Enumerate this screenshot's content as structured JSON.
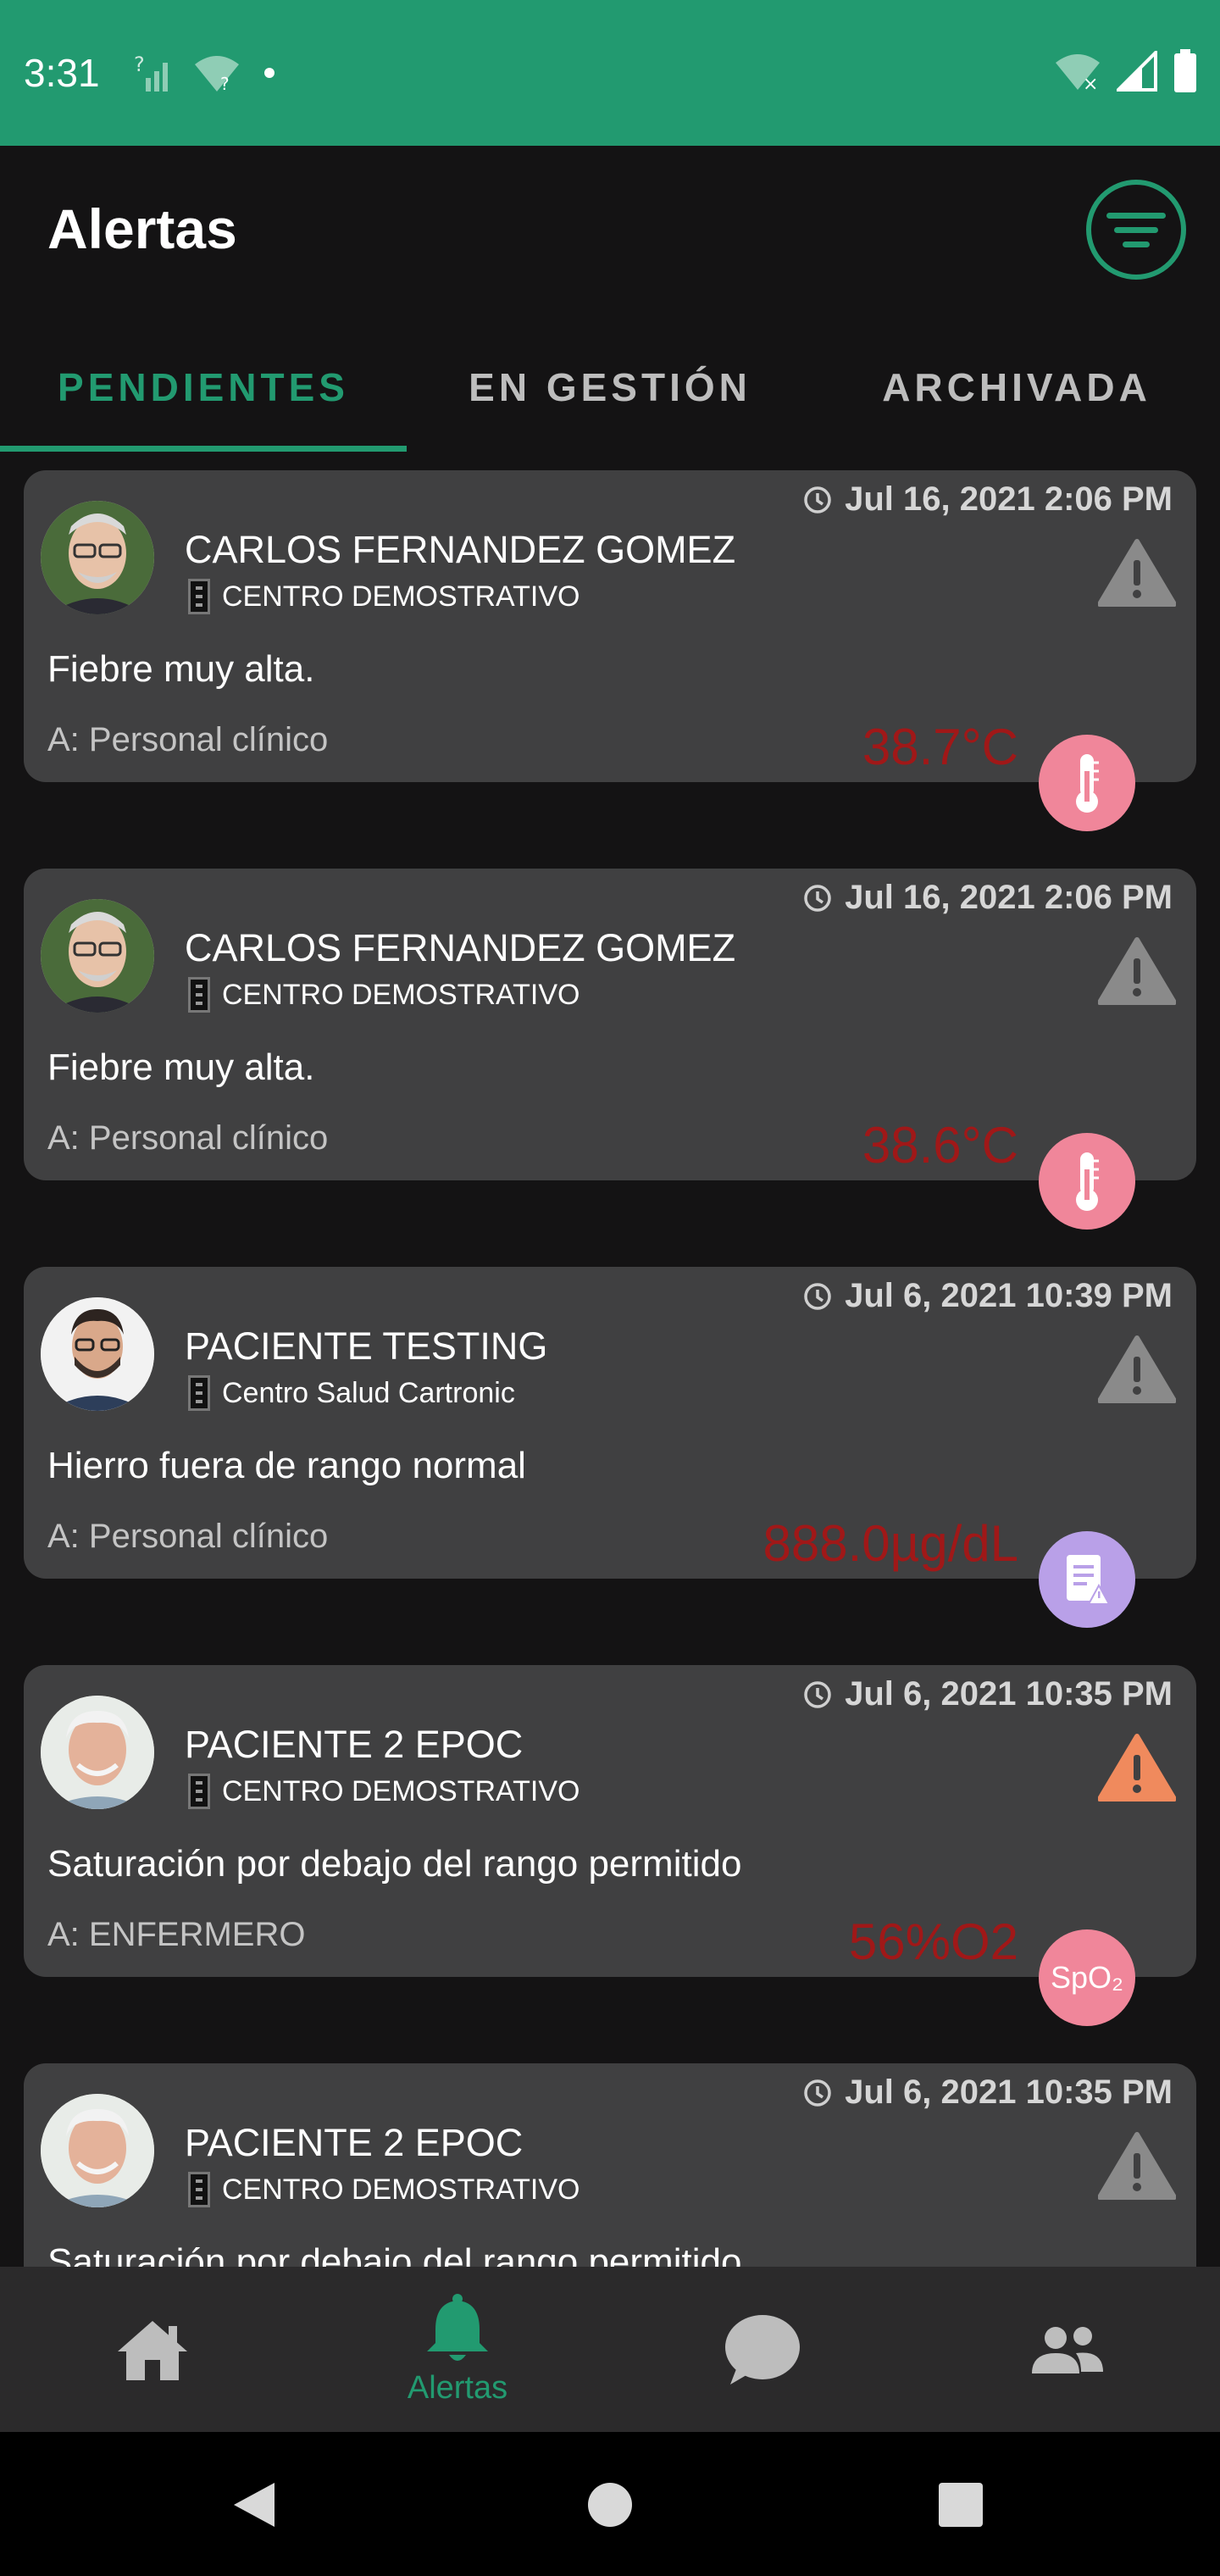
{
  "status_bar": {
    "time": "3:31"
  },
  "header": {
    "title": "Alertas",
    "filter_icon": "filter-icon"
  },
  "tabs": [
    {
      "label": "PENDIENTES",
      "active": true
    },
    {
      "label": "EN GESTIÓN",
      "active": false
    },
    {
      "label": "ARCHIVADA",
      "active": false
    }
  ],
  "alerts": [
    {
      "patient": "CARLOS FERNANDEZ GOMEZ",
      "center": "CENTRO DEMOSTRATIVO",
      "datetime": "Jul 16, 2021 2:06 PM",
      "message": "Fiebre muy alta.",
      "assignee": "A: Personal clínico",
      "value": "38.7°C",
      "type_icon": "thermometer-icon",
      "severity": "gray"
    },
    {
      "patient": "CARLOS FERNANDEZ GOMEZ",
      "center": "CENTRO DEMOSTRATIVO",
      "datetime": "Jul 16, 2021 2:06 PM",
      "message": "Fiebre muy alta.",
      "assignee": "A: Personal clínico",
      "value": "38.6°C",
      "type_icon": "thermometer-icon",
      "severity": "gray"
    },
    {
      "patient": "PACIENTE TESTING",
      "center": "Centro Salud Cartronic",
      "datetime": "Jul 6, 2021 10:39 PM",
      "message": "Hierro fuera de rango normal",
      "assignee": "A: Personal clínico",
      "value": "888.0µg/dL",
      "type_icon": "lab-report-icon",
      "severity": "gray"
    },
    {
      "patient": "PACIENTE 2 EPOC",
      "center": "CENTRO DEMOSTRATIVO",
      "datetime": "Jul 6, 2021 10:35 PM",
      "message": "Saturación por debajo del rango permitido",
      "assignee": "A: ENFERMERO",
      "value": "56%O2",
      "type_icon": "spo2-icon",
      "badge_text": "SpO₂",
      "severity": "orange"
    },
    {
      "patient": "PACIENTE 2 EPOC",
      "center": "CENTRO DEMOSTRATIVO",
      "datetime": "Jul 6, 2021 10:35 PM",
      "message": "Saturación por debajo del rango permitido",
      "assignee": "",
      "value": "",
      "type_icon": "",
      "severity": "gray"
    }
  ],
  "bottom_nav": [
    {
      "icon": "home-icon",
      "label": ""
    },
    {
      "icon": "bell-icon",
      "label": "Alertas",
      "active": true
    },
    {
      "icon": "chat-icon",
      "label": ""
    },
    {
      "icon": "people-icon",
      "label": ""
    }
  ],
  "colors": {
    "accent": "#229a70",
    "card": "#404041",
    "value": "#a01818",
    "warn_gray": "#8a8a8a",
    "warn_orange": "#f08a5d"
  }
}
